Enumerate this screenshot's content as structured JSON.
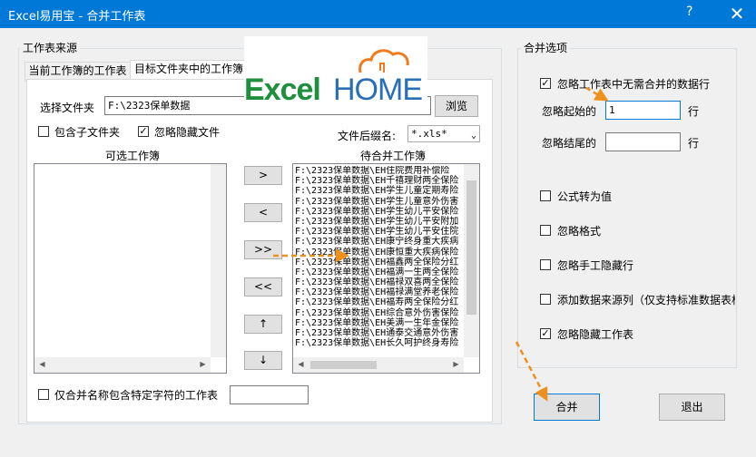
{
  "window": {
    "title": "Excel易用宝 - 合并工作表",
    "help": "?",
    "close": "✕"
  },
  "left_group": {
    "title": "工作表来源",
    "tabs": [
      {
        "label": "当前工作簿的工作表"
      },
      {
        "label": "目标文件夹中的工作簿"
      }
    ],
    "folder_label": "选择文件夹",
    "folder_value": "F:\\2323保单数据",
    "browse_label": "浏览",
    "include_subfolders_label": "包含子文件夹",
    "include_subfolders_checked": false,
    "ignore_hidden_files_label": "忽略隐藏文件",
    "ignore_hidden_files_checked": true,
    "ext_label": "文件后缀名:",
    "ext_value": "*.xls*",
    "available_label": "可选工作簿",
    "pending_label": "待合并工作簿",
    "move_buttons": [
      ">",
      "<",
      ">>",
      "<<",
      "↑",
      "↓"
    ],
    "pending_items": [
      "F:\\2323保单数据\\EH住院费用补偿险",
      "F:\\2323保单数据\\EH千禧理财两全保险",
      "F:\\2323保单数据\\EH学生儿童定期寿险",
      "F:\\2323保单数据\\EH学生儿童意外伤害",
      "F:\\2323保单数据\\EH学生幼儿平安保险",
      "F:\\2323保单数据\\EH学生幼儿平安附加",
      "F:\\2323保单数据\\EH学生幼儿平安住院",
      "F:\\2323保单数据\\EH康宁终身重大疾病",
      "F:\\2323保单数据\\EH康恒重大疾病保险",
      "F:\\2323保单数据\\EH福鑫两全保险分红",
      "F:\\2323保单数据\\EH福满一生两全保险",
      "F:\\2323保单数据\\EH福禄双喜两全保险",
      "F:\\2323保单数据\\EH福禄满堂养老保险",
      "F:\\2323保单数据\\EH福寿两全保险分红",
      "F:\\2323保单数据\\EH综合意外伤害保险",
      "F:\\2323保单数据\\EH美满一生年金保险",
      "F:\\2323保单数据\\EH通泰交通意外伤害",
      "F:\\2323保单数据\\EH长久呵护终身寿险"
    ],
    "filter_label": "仅合并名称包含特定字符的工作表",
    "filter_checked": false,
    "filter_value": ""
  },
  "right_group": {
    "title": "合并选项",
    "ignore_rows_label": "忽略工作表中无需合并的数据行",
    "ignore_rows_checked": true,
    "start_label": "忽略起始的",
    "start_value": "1",
    "start_unit": "行",
    "end_label": "忽略结尾的",
    "end_value": "",
    "end_unit": "行",
    "options": [
      {
        "label": "公式转为值",
        "checked": false
      },
      {
        "label": "忽略格式",
        "checked": false
      },
      {
        "label": "忽略手工隐藏行",
        "checked": false
      },
      {
        "label": "添加数据来源列（仅支持标准数据表格）",
        "checked": false
      },
      {
        "label": "忽略隐藏工作表",
        "checked": true
      }
    ]
  },
  "footer": {
    "merge_label": "合并",
    "exit_label": "退出"
  },
  "logo": {
    "text_left": "Excel",
    "text_right": "HOME",
    "color_green": "#1e8f3c",
    "color_blue": "#2a6fb5",
    "color_orange": "#f07b1d"
  },
  "colors": {
    "titlebar": "#0078d7",
    "annotation_arrow": "#f0901c"
  }
}
